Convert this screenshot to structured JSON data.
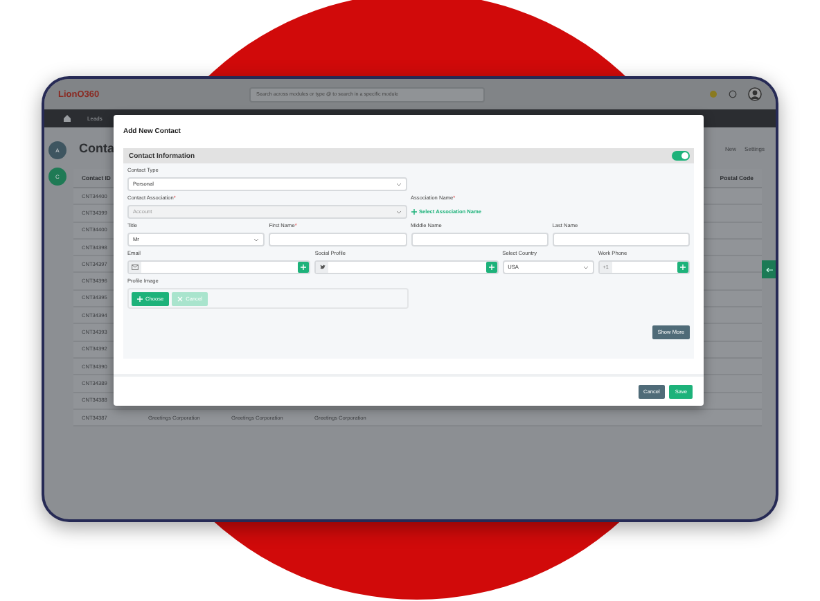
{
  "app": {
    "logo": "LionO360",
    "search": {
      "placeholder": "Search across modules or type @ to search in a specific module"
    },
    "nav": [
      "Leads"
    ],
    "avatars": [
      {
        "letter": "A",
        "color": "#3e5560"
      },
      {
        "letter": "C",
        "color": "#1f7a55"
      }
    ],
    "page_title": "Conta",
    "actions": [
      "New",
      "Settings"
    ],
    "table": {
      "columns": [
        "Contact ID",
        "Postal Code"
      ],
      "rows": [
        {
          "id": "CNT34400"
        },
        {
          "id": "CNT34399"
        },
        {
          "id": "CNT34400"
        },
        {
          "id": "CNT34398"
        },
        {
          "id": "CNT34397"
        },
        {
          "id": "CNT34396"
        },
        {
          "id": "CNT34395"
        },
        {
          "id": "CNT34394"
        },
        {
          "id": "CNT34393"
        },
        {
          "id": "CNT34392"
        },
        {
          "id": "CNT34390"
        },
        {
          "id": "CNT34389"
        },
        {
          "id": "CNT34388"
        },
        {
          "id": "CNT34387",
          "cells": [
            "Greetings Corporation",
            "Greetings Corporation",
            "Greetings Corporation"
          ]
        }
      ]
    }
  },
  "modal": {
    "title": "Add New Contact",
    "section": {
      "title": "Contact Information",
      "on": true
    },
    "rows": [
      [
        {
          "kind": "select",
          "label": "Contact Type",
          "value": "Personal"
        }
      ],
      [
        {
          "kind": "select",
          "label": "Contact Association",
          "required_mark": "*",
          "placeholder": "Account"
        },
        {
          "kind": "link",
          "label": "Association Name",
          "required_mark": "*",
          "link": "Select Association Name"
        }
      ],
      [
        {
          "kind": "select",
          "label": "Title",
          "value": "Mr"
        },
        {
          "kind": "text",
          "label": "First Name",
          "required_mark": "*"
        },
        {
          "kind": "text",
          "label": "Middle Name"
        },
        {
          "kind": "text",
          "label": "Last Name"
        }
      ],
      [
        {
          "kind": "email",
          "label": "Email"
        },
        {
          "kind": "social",
          "label": "Social Profile"
        },
        {
          "kind": "select",
          "label": "Select Country",
          "value": "USA"
        },
        {
          "kind": "phone",
          "label": "Work Phone",
          "prefix": "+1"
        }
      ]
    ],
    "profile_image": {
      "label": "Profile Image",
      "buttons": [
        {
          "label": "Choose",
          "disabled": false
        },
        {
          "label": "Cancel",
          "disabled": true
        }
      ]
    },
    "show_more": "Show More",
    "footer": [
      {
        "label": "Cancel",
        "kind": "secondary"
      },
      {
        "label": "Save",
        "kind": "primary"
      }
    ]
  }
}
